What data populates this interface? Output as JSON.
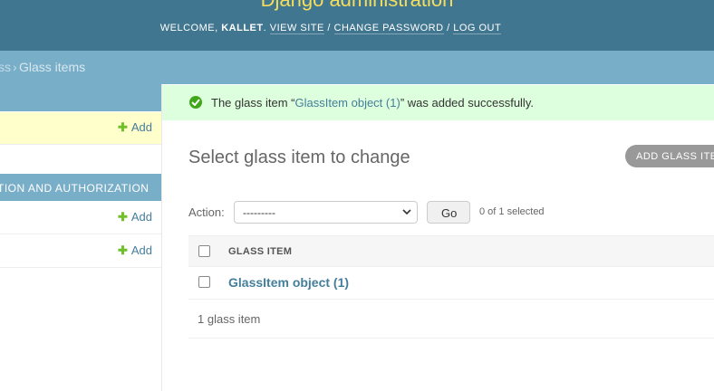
{
  "header": {
    "site_name": "Django administration",
    "welcome": "WELCOME,",
    "username": "KALLET",
    "view_site": "VIEW SITE",
    "change_password": "CHANGE PASSWORD",
    "log_out": "LOG OUT",
    "separator": "/"
  },
  "breadcrumbs": {
    "parent": "ss",
    "separator": "›",
    "current": "Glass items"
  },
  "sidebar": {
    "auth_caption": "TION AND AUTHORIZATION",
    "add_label": "Add",
    "add_icon": "plus-icon"
  },
  "message": {
    "prefix": "The glass item “",
    "object_link": "GlassItem object (1)",
    "suffix": "” was added successfully.",
    "icon": "success-check-icon"
  },
  "page": {
    "title": "Select glass item to change",
    "add_button": "ADD GLASS ITEM"
  },
  "actions": {
    "label": "Action:",
    "selected": "---------",
    "go": "Go",
    "counter": "0 of 1 selected"
  },
  "table": {
    "column_header": "GLASS ITEM",
    "rows": [
      {
        "label": "GlassItem object (1)"
      }
    ]
  },
  "paginator": {
    "text": "1 glass item"
  },
  "colors": {
    "header_bg": "#417690",
    "breadcrumbs_bg": "#79aec8",
    "site_name": "#f5dd5d",
    "link": "#447e9b",
    "success_bg": "#ddffdd",
    "add_plus": "#70bf2b"
  }
}
